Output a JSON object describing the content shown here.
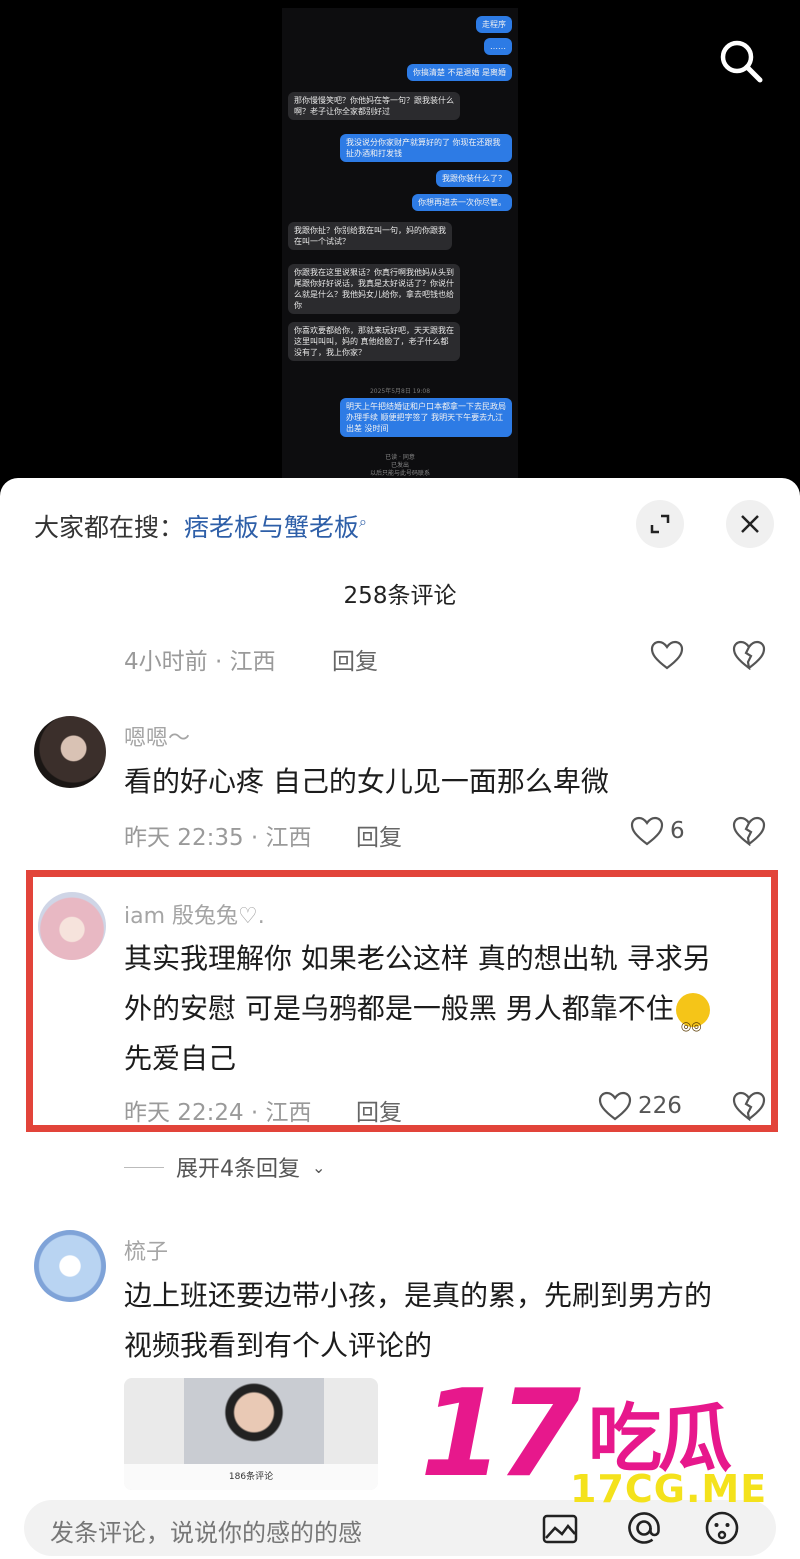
{
  "chat": {
    "messages": [
      {
        "side": "right",
        "text": "走程序"
      },
      {
        "side": "right",
        "text": "……"
      },
      {
        "side": "right",
        "text": "你搞清楚 不是退婚 是离婚"
      },
      {
        "side": "left",
        "text": "那你慢慢笑吧？你他妈在等一句？跟我装什么啊？老子让你全家都别好过"
      },
      {
        "side": "right",
        "text": "我没说分你家财产就算好的了 你现在还跟我扯办酒和打发钱"
      },
      {
        "side": "right",
        "text": "我跟你装什么了？"
      },
      {
        "side": "right",
        "text": "你想再进去一次你尽管。"
      },
      {
        "side": "left",
        "text": "我跟你扯？你别给我在叫一句，妈的你跟我在叫一个试试？"
      },
      {
        "side": "left",
        "text": "你跟我在这里说狠话？你真行啊我他妈从头到尾跟你好好说话，我真是太好说话了？你说什么就是什么？我他妈女儿给你，拿去吧钱也给你"
      },
      {
        "side": "left",
        "text": "你喜欢要都给你，那就来玩好吧，天天跟我在这里叫叫叫，妈的 真他给脸了，老子什么都没有了，我上你家？"
      },
      {
        "side": "right",
        "text": "明天上午把结婚证和户口本都拿一下去民政局办理手续 顺便把字签了 我明天下午要去九江出差 没时间"
      }
    ],
    "timestamp": "2025年5月8日 19:08",
    "footer_1": "已读 · 同意",
    "footer_2": "已发出",
    "footer_3": "以后只能与此号码联系"
  },
  "panel": {
    "hot_label": "大家都在搜：",
    "hot_term": "痞老板与蟹老板",
    "comment_count": "258条评论"
  },
  "comments": [
    {
      "meta": "4小时前 · 江西",
      "reply": "回复",
      "likes": ""
    },
    {
      "name": "嗯嗯～",
      "text": "看的好心疼 自己的女儿见一面那么卑微",
      "meta": "昨天 22:35 · 江西",
      "reply": "回复",
      "likes": "6"
    },
    {
      "name": "iam 殷兔兔♡.",
      "text_1": "其实我理解你 如果老公这样 真的想出轨 寻求另",
      "text_2": "外的安慰 可是乌鸦都是一般黑 男人都靠不住",
      "text_3": "先爱自己",
      "meta": "昨天 22:24 · 江西",
      "reply": "回复",
      "likes": "226",
      "expand": "展开4条回复"
    },
    {
      "name": "梳子",
      "text_1": "边上班还要边带小孩，是真的累，先刷到男方的",
      "text_2": "视频我看到有个人评论的",
      "thumb_count": "186条评论"
    }
  ],
  "composer": {
    "placeholder": "发条评论，说说你的感的的感"
  },
  "watermark": {
    "number": "17",
    "chinese": "吃瓜",
    "url": "17CG.ME"
  },
  "colors": {
    "accent": "#2e5fa8",
    "highlight": "#e2443a",
    "watermark": "#e7188c",
    "watermark_url": "#f4e21c"
  }
}
